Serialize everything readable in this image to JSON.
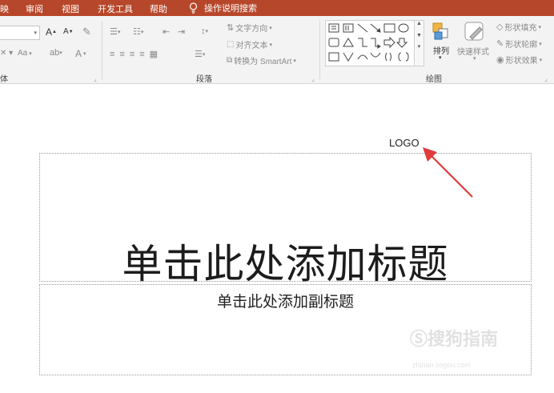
{
  "colors": {
    "menubar": "#b7472a",
    "arrow": "#e03c3c",
    "ribbon": "#f3f3f3"
  },
  "menubar": {
    "tabs": [
      "映",
      "审阅",
      "视图",
      "开发工具",
      "帮助"
    ],
    "tell_me": "操作说明搜索"
  },
  "ribbon": {
    "font_group": {
      "label": "体",
      "font_size": "",
      "grow": "A",
      "shrink": "A",
      "color_label": "A",
      "case_label": "Aa"
    },
    "paragraph_group": {
      "label": "段落",
      "text_direction": "文字方向",
      "align_text": "对齐文本",
      "convert_smartart": "转换为 SmartArt"
    },
    "drawing_group": {
      "label": "绘图",
      "arrange": "排列",
      "quick_styles": "快速样式",
      "shape_fill": "形状填充",
      "shape_outline": "形状轮廓",
      "shape_effects": "形状效果"
    }
  },
  "slide": {
    "logo": "LOGO",
    "title_placeholder": "单击此处添加标题",
    "subtitle_placeholder": "单击此处添加副标题",
    "watermark": "搜狗指南",
    "watermark_sub": "zhinan.sogou.com"
  }
}
